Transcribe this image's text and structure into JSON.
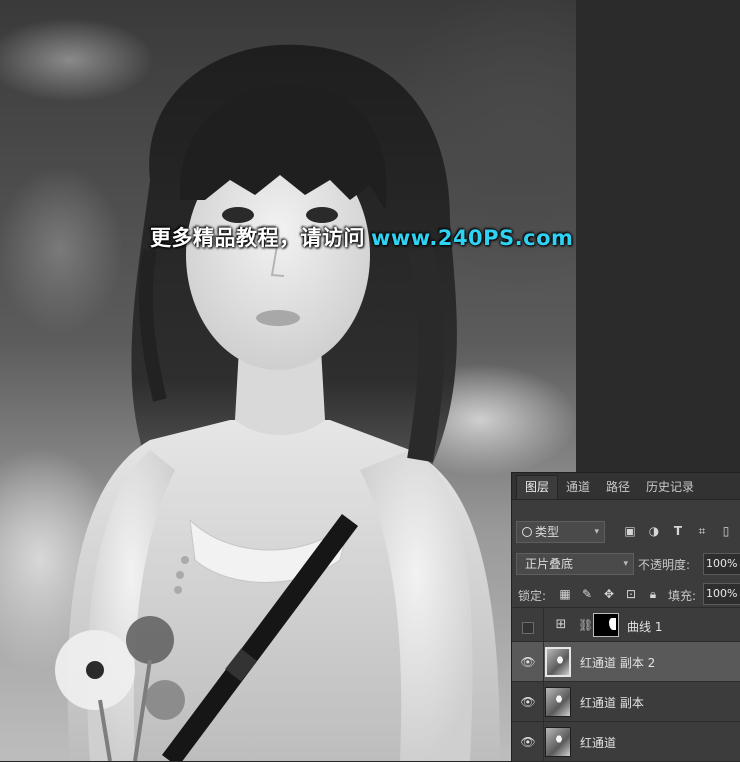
{
  "watermark": {
    "text": "更多精品教程，请访问",
    "url": "www.240PS.com"
  },
  "panel_tabs": [
    {
      "label": "图层",
      "active": true
    },
    {
      "label": "通道",
      "active": false
    },
    {
      "label": "路径",
      "active": false
    },
    {
      "label": "历史记录",
      "active": false
    }
  ],
  "filter": {
    "label": "类型",
    "icons": [
      "image-filter-icon",
      "adjustment-filter-icon",
      "type-filter-icon",
      "shape-filter-icon",
      "smart-object-filter-icon"
    ]
  },
  "blend": {
    "mode": "正片叠底",
    "opacity_label": "不透明度:",
    "opacity_value": "100%"
  },
  "lock": {
    "label": "锁定:",
    "fill_label": "填充:",
    "fill_value": "100%",
    "icons": [
      "lock-transparent-icon",
      "lock-pixels-icon",
      "lock-position-icon",
      "lock-artboard-icon",
      "lock-all-icon"
    ]
  },
  "layers": [
    {
      "name": "曲线 1",
      "visible": false,
      "selected": false,
      "type": "adjustment"
    },
    {
      "name": "红通道 副本 2",
      "visible": true,
      "selected": true,
      "type": "pixel"
    },
    {
      "name": "红通道 副本",
      "visible": true,
      "selected": false,
      "type": "pixel"
    },
    {
      "name": "红通道",
      "visible": true,
      "selected": false,
      "type": "pixel"
    }
  ],
  "colors": {
    "watermark_url": "#2fd2f2",
    "panel_bg": "#3c3c3c",
    "selected_layer": "#595959"
  }
}
